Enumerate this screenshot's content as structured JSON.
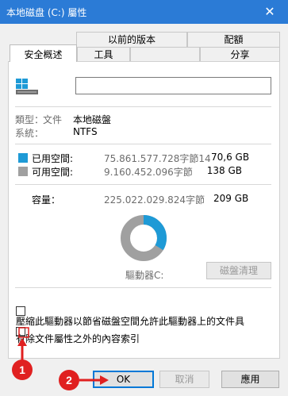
{
  "window": {
    "title": "本地磁盘 (C:) 屬性",
    "close_glyph": "✕"
  },
  "tabs": {
    "row_back": [
      "以前的版本",
      "配額"
    ],
    "row_front": [
      "安全概述",
      "工具",
      "",
      "分享"
    ]
  },
  "volume": {
    "name_value": "",
    "type_label": "類型：",
    "type_value": "本地磁盤",
    "type_word": "文件",
    "fs_label": "系統：",
    "fs_value": "NTFS"
  },
  "usage": {
    "used_label": "已用空間:",
    "used_bytes": "75.861.577.728字節14",
    "used_gb": "70,6 GB",
    "used_color": "#1e9ad6",
    "free_label": "可用空間:",
    "free_bytes": "9.160.452.096字節",
    "free_gb": "138 GB",
    "free_color": "#a0a0a0",
    "capacity_label": "容量：",
    "capacity_bytes": "225.022.029.824字節",
    "capacity_gb": "209 GB",
    "used_fraction": 0.337
  },
  "drive_label": "驅動器C:",
  "cleanup_button": "磁盤清理",
  "options": {
    "compress_text": "壓縮此驅動器以節省磁盤空間允許此驅動器上的文件具",
    "index_text": "有除文件屬性之外的內容索引"
  },
  "buttons": {
    "ok": "OK",
    "cancel": "取消",
    "apply": "應用"
  },
  "annotations": {
    "badge1": "1",
    "badge2": "2",
    "accent": "#e02020"
  }
}
